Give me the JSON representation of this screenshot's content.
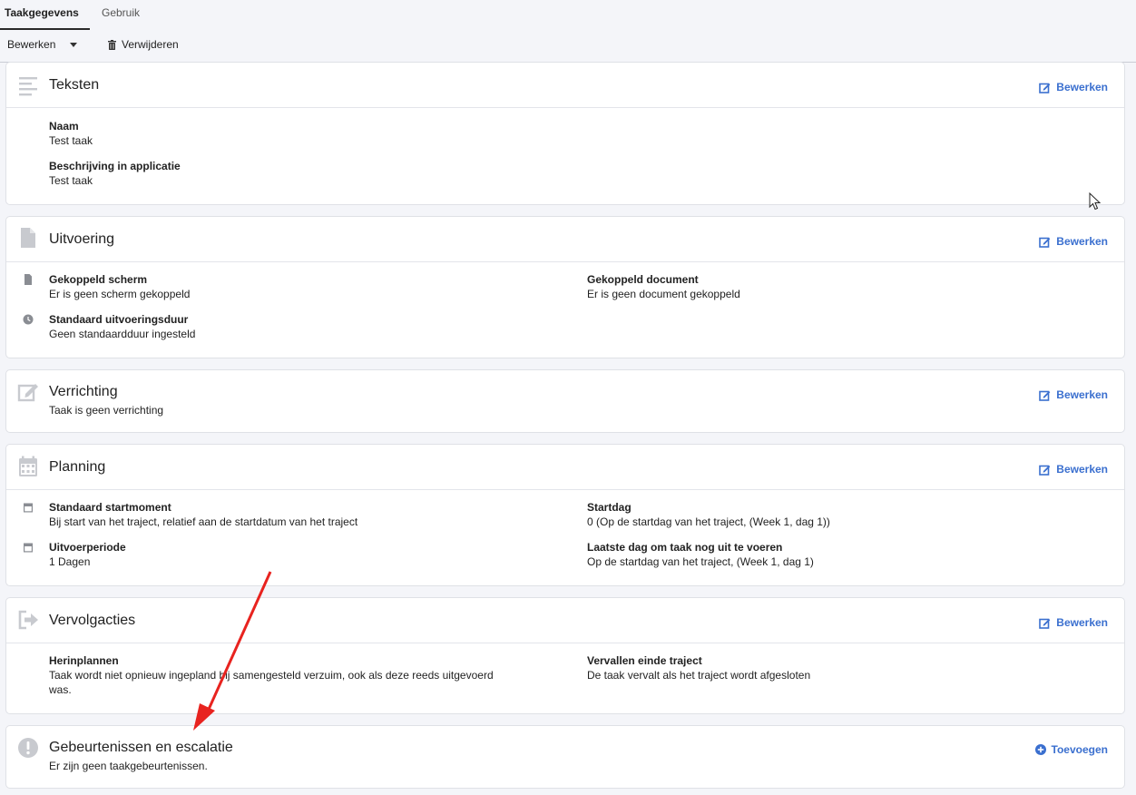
{
  "tabs": [
    {
      "label": "Taakgegevens",
      "active": true
    },
    {
      "label": "Gebruik",
      "active": false
    }
  ],
  "toolbar": {
    "edit_label": "Bewerken",
    "delete_label": "Verwijderen"
  },
  "accent_color": "#3a6fcf",
  "sections": {
    "teksten": {
      "title": "Teksten",
      "action": "Bewerken",
      "fields": [
        {
          "label": "Naam",
          "value": "Test taak"
        },
        {
          "label": "Beschrijving in applicatie",
          "value": "Test taak"
        }
      ]
    },
    "uitvoering": {
      "title": "Uitvoering",
      "action": "Bewerken",
      "fields": [
        {
          "label": "Gekoppeld scherm",
          "value": "Er is geen scherm gekoppeld"
        },
        {
          "label": "Gekoppeld document",
          "value": "Er is geen document gekoppeld"
        },
        {
          "label": "Standaard uitvoeringsduur",
          "value": "Geen standaardduur ingesteld"
        }
      ]
    },
    "verrichting": {
      "title": "Verrichting",
      "action": "Bewerken",
      "subtitle": "Taak is geen verrichting"
    },
    "planning": {
      "title": "Planning",
      "action": "Bewerken",
      "fields": [
        {
          "label": "Standaard startmoment",
          "value": "Bij start van het traject, relatief aan de startdatum van het traject"
        },
        {
          "label": "Startdag",
          "value": "0 (Op de startdag van het traject, (Week 1, dag 1))"
        },
        {
          "label": "Uitvoerperiode",
          "value": "1 Dagen"
        },
        {
          "label": "Laatste dag om taak nog uit te voeren",
          "value": "Op de startdag van het traject, (Week 1, dag 1)"
        }
      ]
    },
    "vervolgacties": {
      "title": "Vervolgacties",
      "action": "Bewerken",
      "fields": [
        {
          "label": "Herinplannen",
          "value_line1": "Taak wordt niet opnieuw ingepland bij samengesteld verzuim, ook als deze reeds uitgevoerd",
          "value_line2": "was."
        },
        {
          "label": "Vervallen einde traject",
          "value": "De taak vervalt als het traject wordt afgesloten"
        }
      ]
    },
    "gebeurtenissen": {
      "title": "Gebeurtenissen en escalatie",
      "action": "Toevoegen",
      "subtitle": "Er zijn geen taakgebeurtenissen."
    }
  }
}
